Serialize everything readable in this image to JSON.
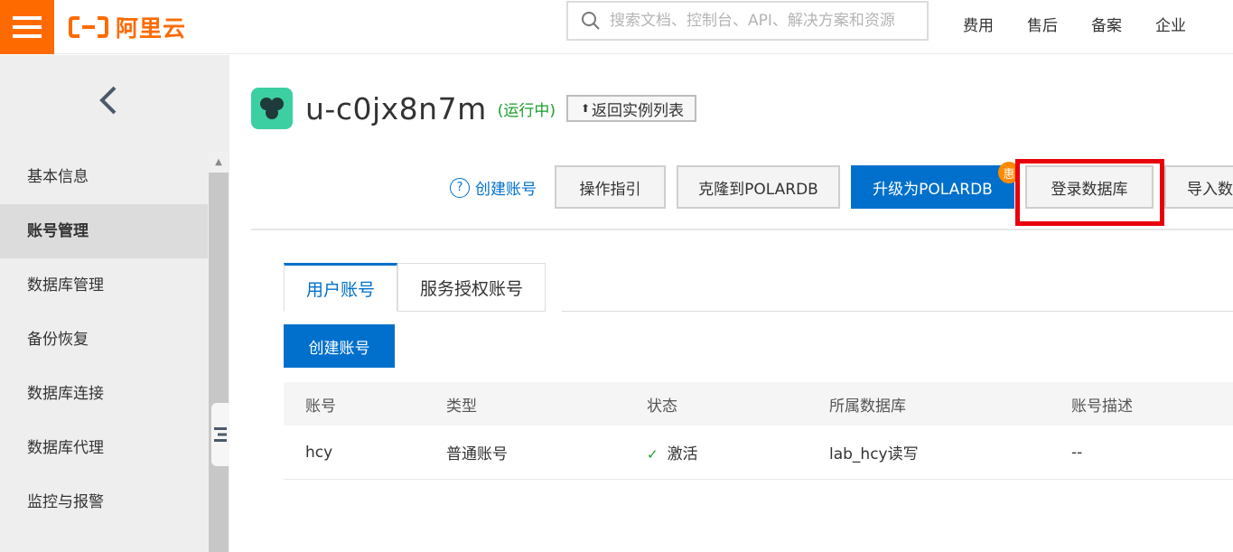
{
  "header": {
    "logo_text": "阿里云",
    "search_placeholder": "搜索文档、控制台、API、解决方案和资源",
    "nav": [
      "费用",
      "售后",
      "备案",
      "企业"
    ],
    "brand_color": "#ff6a00"
  },
  "sidebar": {
    "items": [
      {
        "label": "基本信息",
        "active": false
      },
      {
        "label": "账号管理",
        "active": true
      },
      {
        "label": "数据库管理",
        "active": false
      },
      {
        "label": "备份恢复",
        "active": false
      },
      {
        "label": "数据库连接",
        "active": false
      },
      {
        "label": "数据库代理",
        "active": false
      },
      {
        "label": "监控与报警",
        "active": false
      }
    ]
  },
  "instance": {
    "name": "u-c0jx8n7m",
    "status": "(运行中)",
    "return_label": "返回实例列表"
  },
  "actions": {
    "help_link": "创建账号",
    "guide": "操作指引",
    "clone": "克隆到POLARDB",
    "upgrade": "升级为POLARDB",
    "upgrade_badge": "惠",
    "login_db": "登录数据库",
    "import": "导入数"
  },
  "tabs": [
    "用户账号",
    "服务授权账号"
  ],
  "create_button": "创建账号",
  "table": {
    "columns": [
      "账号",
      "类型",
      "状态",
      "所属数据库",
      "账号描述"
    ],
    "rows": [
      {
        "account": "hcy",
        "type": "普通账号",
        "status": "激活",
        "database": "lab_hcy读写",
        "description": "--"
      }
    ]
  },
  "colors": {
    "primary": "#0070cc",
    "success": "#1a9e2e",
    "highlight": "#e8000c",
    "badge": "#ff8a00"
  }
}
